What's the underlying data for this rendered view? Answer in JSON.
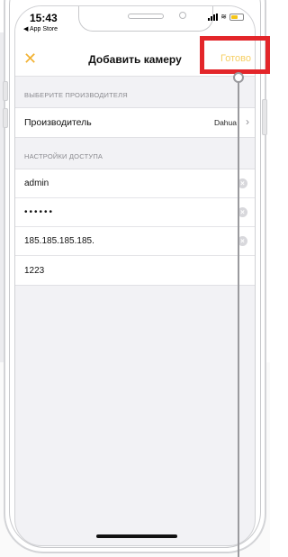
{
  "status_bar": {
    "time": "15:43",
    "back_app": "◀ App Store"
  },
  "nav": {
    "close_icon": "close-icon",
    "title": "Добавить камеру",
    "done_label": "Готово"
  },
  "manufacturer_section": {
    "header": "ВЫБЕРИТЕ ПРОИЗВОДИТЕЛЯ",
    "row_label": "Производитель",
    "row_value": "Dahua"
  },
  "access_section": {
    "header": "НАСТРОЙКИ ДОСТУПА",
    "username": "admin",
    "password_masked": "••••••",
    "address": "185.185.185.185.",
    "port": "1223"
  },
  "colors": {
    "accent": "#f2b233",
    "done_disabled": "#f6cf64",
    "highlight": "#e3262a"
  }
}
